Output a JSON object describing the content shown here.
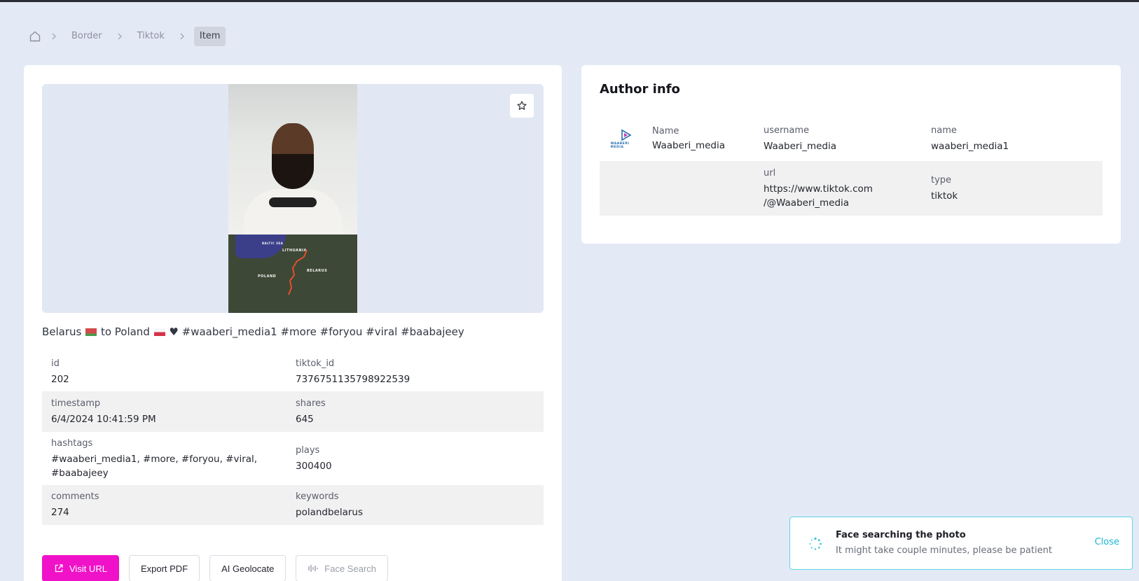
{
  "breadcrumb": {
    "home_icon": "home-icon",
    "items": [
      "Border",
      "Tiktok",
      "Item"
    ]
  },
  "post": {
    "caption_before": "Belarus",
    "caption_mid": "to Poland",
    "caption_after": "♥ #waaberi_media1 #more #foryou #viral #baabajeey",
    "map_labels": {
      "sea": "BALTIC SEA",
      "lithuania": "LITHUANIA",
      "poland": "POLAND",
      "belarus": "BELARUS"
    },
    "details": [
      {
        "l_label": "id",
        "l_value": "202",
        "r_label": "tiktok_id",
        "r_value": "7376751135798922539"
      },
      {
        "l_label": "timestamp",
        "l_value": "6/4/2024 10:41:59 PM",
        "r_label": "shares",
        "r_value": "645"
      },
      {
        "l_label": "hashtags",
        "l_value": "#waaberi_media1, #more, #foryou, #viral, #baabajeey",
        "r_label": "plays",
        "r_value": "300400"
      },
      {
        "l_label": "comments",
        "l_value": "274",
        "r_label": "keywords",
        "r_value": "polandbelarus"
      }
    ],
    "actions": {
      "visit_url": "Visit URL",
      "export_pdf": "Export PDF",
      "ai_geolocate": "AI Geolocate",
      "face_search": "Face Search"
    }
  },
  "author": {
    "title": "Author info",
    "avatar_text": "WAABERI MEDIA",
    "name_label": "Name",
    "name_value": "Waaberi_media",
    "username_label": "username",
    "username_value": "Waaberi_media",
    "name2_label": "name",
    "name2_value": "waaberi_media1",
    "url_label": "url",
    "url_value_1": "https://www.tiktok.com",
    "url_value_2": "/@Waaberi_media",
    "type_label": "type",
    "type_value": "tiktok"
  },
  "toast": {
    "title": "Face searching the photo",
    "subtitle": "It might take couple minutes, please be patient",
    "close": "Close"
  },
  "colors": {
    "accent": "#f012c9",
    "toast_border": "#5fd5ea",
    "toast_link": "#19b8d6",
    "background": "#e4e9f6"
  }
}
